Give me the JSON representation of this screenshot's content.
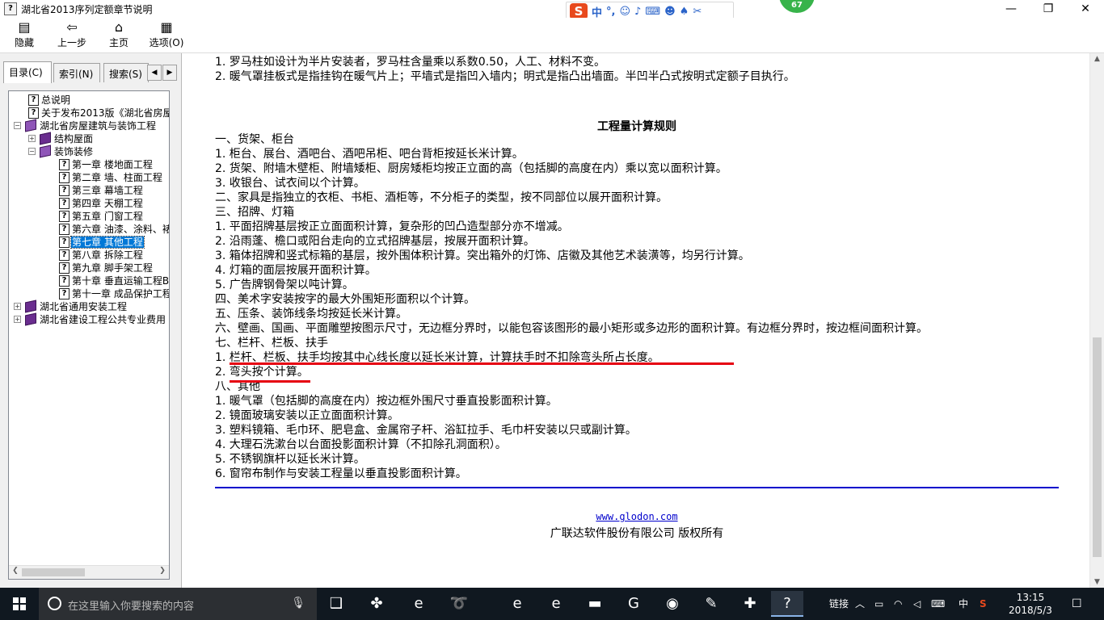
{
  "window": {
    "title": "湖北省2013序列定额章节说明",
    "app_icon": "help-book-icon",
    "minimize_glyph": "—",
    "restore_glyph": "❐",
    "close_glyph": "✕",
    "ime_logo": "S",
    "ime_lang": "中",
    "ime_punct": "°,",
    "ime_icons": [
      "smiley-icon",
      "mic-icon",
      "keyboard-icon",
      "user-icon",
      "shirt-icon",
      "wrench-icon"
    ],
    "notification_count": "67"
  },
  "toolbar": {
    "buttons": [
      {
        "label": "隐藏",
        "icon": "hide-pane-icon"
      },
      {
        "label": "上一步",
        "icon": "back-arrow-icon"
      },
      {
        "label": "主页",
        "icon": "home-icon"
      },
      {
        "label": "选项(O)",
        "icon": "options-icon"
      }
    ]
  },
  "sidebar": {
    "tabs": [
      {
        "label": "目录(C)",
        "active": true
      },
      {
        "label": "索引(N)",
        "active": false
      },
      {
        "label": "搜索(S)",
        "active": false
      }
    ],
    "tree": [
      {
        "label": "总说明",
        "type": "page",
        "level": 1
      },
      {
        "label": "关于发布2013版《湖北省房屋",
        "type": "page",
        "level": 1
      },
      {
        "label": "湖北省房屋建筑与装饰工程",
        "type": "book-open",
        "level": 0,
        "expander": "−"
      },
      {
        "label": "结构屋面",
        "type": "book",
        "level": 1,
        "expander": "+"
      },
      {
        "label": "装饰装修",
        "type": "book-open",
        "level": 1,
        "expander": "−"
      },
      {
        "label": "第一章  楼地面工程",
        "type": "page",
        "level": 2
      },
      {
        "label": "第二章  墙、柱面工程",
        "type": "page",
        "level": 2
      },
      {
        "label": "第三章  幕墙工程",
        "type": "page",
        "level": 2
      },
      {
        "label": "第四章  天棚工程",
        "type": "page",
        "level": 2
      },
      {
        "label": "第五章  门窗工程",
        "type": "page",
        "level": 2
      },
      {
        "label": "第六章  油漆、涂料、裱",
        "type": "page",
        "level": 2
      },
      {
        "label": "第七章  其他工程",
        "type": "page",
        "level": 2,
        "selected": true
      },
      {
        "label": "第八章  拆除工程",
        "type": "page",
        "level": 2
      },
      {
        "label": "第九章  脚手架工程",
        "type": "page",
        "level": 2
      },
      {
        "label": "第十章  垂直运输工程B",
        "type": "page",
        "level": 2
      },
      {
        "label": "第十一章  成品保护工程",
        "type": "page",
        "level": 2
      },
      {
        "label": "湖北省通用安装工程",
        "type": "book",
        "level": 0,
        "expander": "+"
      },
      {
        "label": "湖北省建设工程公共专业费用",
        "type": "book",
        "level": 0,
        "expander": "+"
      }
    ]
  },
  "content": {
    "top_lines": [
      "1. 罗马柱如设计为半片安装者，罗马柱含量乘以系数0.50，人工、材料不变。",
      "2. 暖气罩挂板式是指挂钩在暖气片上；平墙式是指凹入墙内；明式是指凸出墙面。半凹半凸式按明式定额子目执行。"
    ],
    "section_title": "工程量计算规则",
    "rules": [
      "一、货架、柜台",
      "1. 柜台、展台、酒吧台、酒吧吊柜、吧台背柜按延长米计算。",
      "2. 货架、附墙木壁柜、附墙矮柜、厨房矮柜均按正立面的高（包括脚的高度在内）乘以宽以面积计算。",
      "3. 收银台、试衣间以个计算。",
      "二、家具是指独立的衣柜、书柜、酒柜等，不分柜子的类型，按不同部位以展开面积计算。",
      "三、招牌、灯箱",
      "1. 平面招牌基层按正立面面积计算，复杂形的凹凸造型部分亦不增减。",
      "2. 沿雨蓬、檐口或阳台走向的立式招牌基层，按展开面积计算。",
      "3. 箱体招牌和竖式标箱的基层，按外围体积计算。突出箱外的灯饰、店徽及其他艺术装潢等，均另行计算。",
      "4. 灯箱的面层按展开面积计算。",
      "5. 广告牌钢骨架以吨计算。",
      "四、美术字安装按字的最大外围矩形面积以个计算。",
      "五、压条、装饰线条均按延长米计算。",
      "六、壁画、国画、平面雕塑按图示尺寸，无边框分界时，以能包容该图形的最小矩形或多边形的面积计算。有边框分界时，按边框间面积计算。",
      "七、栏杆、栏板、扶手",
      "1. 栏杆、栏板、扶手均按其中心线长度以延长米计算，计算扶手时不扣除弯头所占长度。",
      "2. 弯头按个计算。",
      "八、其他",
      "1. 暖气罩（包括脚的高度在内）按边框外围尺寸垂直投影面积计算。",
      "2. 镜面玻璃安装以正立面面积计算。",
      "3. 塑料镜箱、毛巾环、肥皂盒、金属帘子杆、浴缸拉手、毛巾杆安装以只或副计算。",
      "4. 大理石洗漱台以台面投影面积计算（不扣除孔洞面积）。",
      "5. 不锈钢旗杆以延长米计算。",
      "6. 窗帘布制作与安装工程量以垂直投影面积计算。"
    ],
    "link": "www.glodon.com",
    "copyright": "广联达软件股份有限公司 版权所有",
    "annotation_color": "#e60012",
    "rule_color": "#0000cc"
  },
  "taskbar": {
    "search_placeholder": "在这里输入你要搜索的内容",
    "apps": [
      {
        "name": "task-view-icon",
        "glyph": "❑"
      },
      {
        "name": "pinwheel-app-icon",
        "glyph": "✤"
      },
      {
        "name": "ie-icon",
        "glyph": "e"
      },
      {
        "name": "swirl-app-icon",
        "glyph": "➰"
      },
      {
        "name": "edge-icon",
        "glyph": "e"
      },
      {
        "name": "ie-blue-icon",
        "glyph": "e"
      },
      {
        "name": "file-explorer-icon",
        "glyph": "▬"
      },
      {
        "name": "glodon-g-icon",
        "glyph": "G"
      },
      {
        "name": "green-browser-icon",
        "glyph": "◉"
      },
      {
        "name": "notes-app-icon",
        "glyph": "✎"
      },
      {
        "name": "plus-app-icon",
        "glyph": "✚"
      },
      {
        "name": "help-file-icon",
        "glyph": "?"
      }
    ],
    "tray_link_label": "链接",
    "tray_lang": "中",
    "clock_time": "13:15",
    "clock_date": "2018/5/3"
  }
}
